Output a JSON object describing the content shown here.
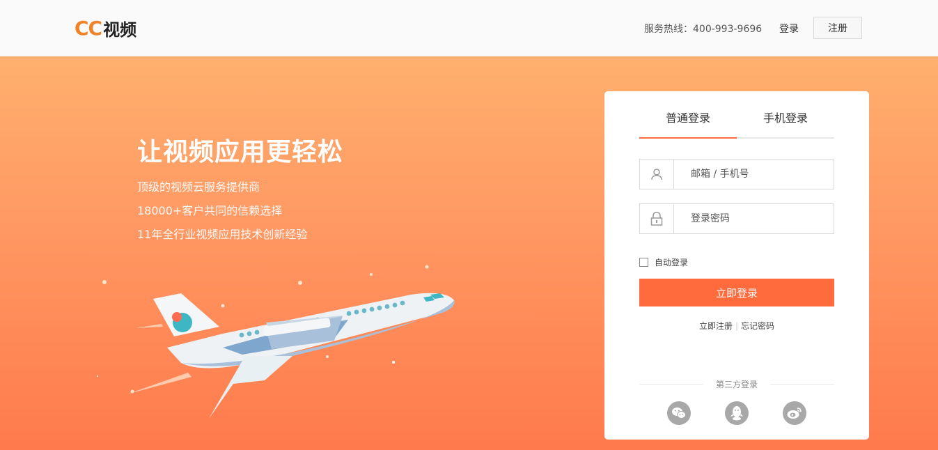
{
  "header": {
    "logo_mark": "CC",
    "logo_text": "视频",
    "hotline": "服务热线：400-993-9696",
    "login_label": "登录",
    "register_label": "注册"
  },
  "hero": {
    "title": "让视频应用更轻松",
    "lines": [
      "顶级的视频云服务提供商",
      "18000+客户共同的信赖选择",
      "11年全行业视频应用技术创新经验"
    ]
  },
  "login": {
    "tabs": [
      {
        "label": "普通登录",
        "active": true
      },
      {
        "label": "手机登录",
        "active": false
      }
    ],
    "username_placeholder": "邮箱 / 手机号",
    "password_placeholder": "登录密码",
    "auto_login_label": "自动登录",
    "submit_label": "立即登录",
    "register_link": "立即注册",
    "forgot_link": "忘记密码",
    "third_party_title": "第三方登录",
    "third_party": [
      "wechat-icon",
      "qq-icon",
      "weibo-icon"
    ]
  },
  "colors": {
    "accent": "#ff6b3d",
    "logo": "#f08228",
    "hero_top": "#ffb06e",
    "hero_bottom": "#ff7a4c"
  }
}
